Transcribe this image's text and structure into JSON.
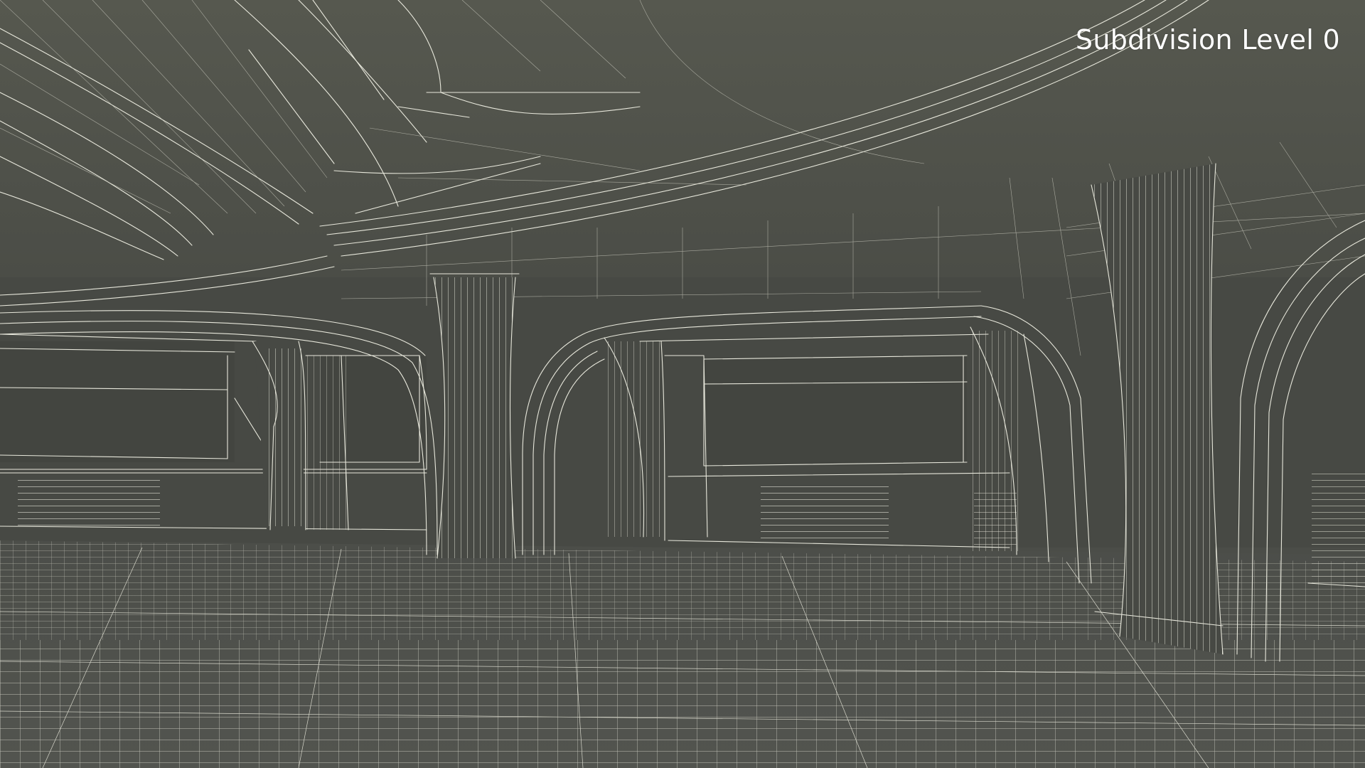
{
  "overlay": {
    "label": "Subdivision Level 0"
  },
  "scene": {
    "description_colors": {
      "background": "#4b4d48",
      "ceiling": "#52544f",
      "wall": "#464843",
      "floor": "#4f514c",
      "wireframe": "#e8e8dc"
    }
  }
}
